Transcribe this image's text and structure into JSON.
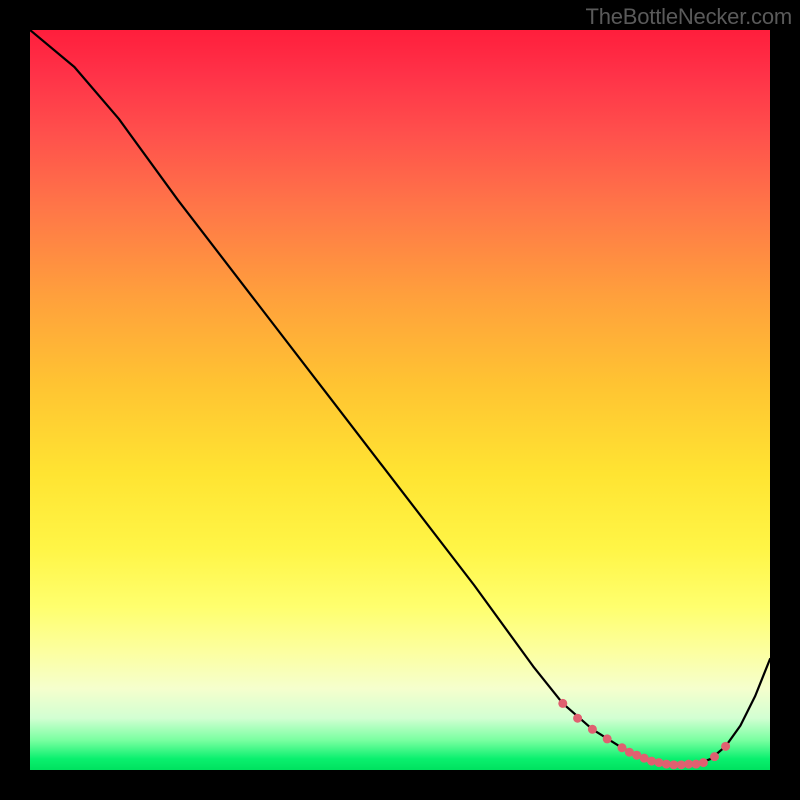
{
  "watermark": "TheBottleNecker.com",
  "chart_data": {
    "type": "line",
    "title": "",
    "xlabel": "",
    "ylabel": "",
    "xlim": [
      0,
      100
    ],
    "ylim": [
      0,
      100
    ],
    "background_gradient": {
      "orientation": "vertical",
      "stops": [
        {
          "pos": 0.0,
          "color": "#ff1e3c"
        },
        {
          "pos": 0.06,
          "color": "#ff3248"
        },
        {
          "pos": 0.14,
          "color": "#ff504c"
        },
        {
          "pos": 0.24,
          "color": "#ff7648"
        },
        {
          "pos": 0.36,
          "color": "#ffa03c"
        },
        {
          "pos": 0.48,
          "color": "#ffc432"
        },
        {
          "pos": 0.6,
          "color": "#ffe432"
        },
        {
          "pos": 0.7,
          "color": "#fff546"
        },
        {
          "pos": 0.78,
          "color": "#ffff6e"
        },
        {
          "pos": 0.84,
          "color": "#fcffa0"
        },
        {
          "pos": 0.89,
          "color": "#f5ffcd"
        },
        {
          "pos": 0.93,
          "color": "#d2ffd2"
        },
        {
          "pos": 0.96,
          "color": "#78ffa0"
        },
        {
          "pos": 0.985,
          "color": "#0af06e"
        },
        {
          "pos": 1.0,
          "color": "#00e15f"
        }
      ]
    },
    "series": [
      {
        "name": "curve",
        "color": "#000000",
        "x": [
          0,
          6,
          12,
          20,
          30,
          40,
          50,
          60,
          68,
          72,
          76,
          80,
          82,
          84,
          86,
          88,
          90,
          92,
          94,
          96,
          98,
          100
        ],
        "y": [
          100,
          95,
          88,
          77,
          64,
          51,
          38,
          25,
          14,
          9,
          5.5,
          3,
          2,
          1.2,
          0.8,
          0.7,
          0.8,
          1.5,
          3.2,
          6,
          10,
          15
        ]
      }
    ],
    "markers": {
      "name": "highlight",
      "color": "#e06070",
      "radius": 4.5,
      "x": [
        72,
        74,
        76,
        78,
        80,
        81,
        82,
        83,
        84,
        85,
        86,
        87,
        88,
        89,
        90,
        91,
        92.5,
        94
      ],
      "y": [
        9,
        7,
        5.5,
        4.2,
        3,
        2.4,
        2,
        1.6,
        1.2,
        1.0,
        0.8,
        0.7,
        0.7,
        0.8,
        0.8,
        1.0,
        1.8,
        3.2
      ]
    }
  }
}
